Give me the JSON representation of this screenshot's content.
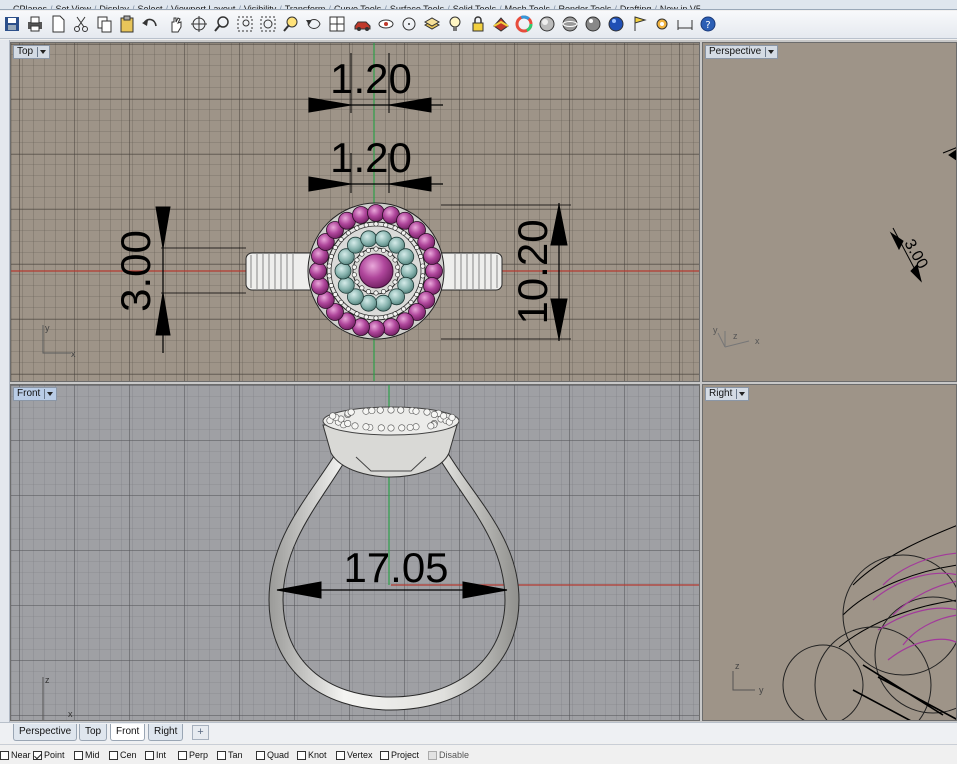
{
  "toolbar_tabs": [
    "CPlanes",
    "Set View",
    "Display",
    "Select",
    "Viewport Layout",
    "Visibility",
    "Transform",
    "Curve Tools",
    "Surface Tools",
    "Solid Tools",
    "Mesh Tools",
    "Render Tools",
    "Drafting",
    "New in V5"
  ],
  "toolbar_icons": [
    "save-icon",
    "print-icon",
    "new-icon",
    "cut-icon",
    "copy-icon",
    "paste-icon",
    "undo-icon",
    "pan-hand-icon",
    "rotate-view-icon",
    "zoom-icon",
    "zoom-window-icon",
    "zoom-extents-icon",
    "zoom-selected-icon",
    "undo-view-icon",
    "four-viewports-icon",
    "car-icon",
    "eye-icon",
    "circle-curve-icon",
    "layer-icon",
    "light-icon",
    "lock-icon",
    "material-icon",
    "color-wheel-icon",
    "shaded-sphere-icon",
    "render-sphere-icon",
    "rendered-sphere-icon",
    "blue-sphere-icon",
    "flag-icon",
    "gear-options-icon",
    "dimension-icon",
    "help-icon"
  ],
  "viewports": {
    "top": {
      "title": "Top",
      "axes": {
        "a": "y",
        "b": "x"
      }
    },
    "perspective": {
      "title": "Perspective",
      "axes": {
        "a": "z",
        "b": "x",
        "c": "y"
      }
    },
    "front": {
      "title": "Front",
      "axes": {
        "a": "z",
        "b": "x"
      }
    },
    "right": {
      "title": "Right",
      "axes": {
        "a": "z",
        "b": "y"
      }
    }
  },
  "dimensions": {
    "top_width_1": "1.20",
    "top_width_2": "1.20",
    "top_left_height": "3.00",
    "top_right_height": "10.20",
    "persp_label": "3.00",
    "front_width": "17.05"
  },
  "viewport_tabs": [
    {
      "label": "Perspective",
      "active": false
    },
    {
      "label": "Top",
      "active": false
    },
    {
      "label": "Front",
      "active": true
    },
    {
      "label": "Right",
      "active": false
    }
  ],
  "add_tab_glyph": "+",
  "osnaps": [
    {
      "label": "Near",
      "checked": false
    },
    {
      "label": "Point",
      "checked": true
    },
    {
      "label": "Mid",
      "checked": false
    },
    {
      "label": "Cen",
      "checked": false
    },
    {
      "label": "Int",
      "checked": false
    },
    {
      "label": "Perp",
      "checked": false
    },
    {
      "label": "Tan",
      "checked": false
    },
    {
      "label": "Quad",
      "checked": false
    },
    {
      "label": "Knot",
      "checked": false
    },
    {
      "label": "Vertex",
      "checked": false
    },
    {
      "label": "Project",
      "checked": false
    },
    {
      "label": "Disable",
      "checked": false,
      "disabled": true
    }
  ],
  "colors": {
    "grid_bg_top": "#9e9488",
    "grid_bg_front": "#9fa0a4",
    "grid_bg_persp": "#9e9488",
    "grid_line": "#7d756b",
    "grid_major": "#5a544c",
    "axis_red": "#c0392b",
    "axis_green": "#2ea04a",
    "gem_pink": "#b0479c",
    "gem_teal": "#86b2ad",
    "metal": "#e7e7e5"
  }
}
